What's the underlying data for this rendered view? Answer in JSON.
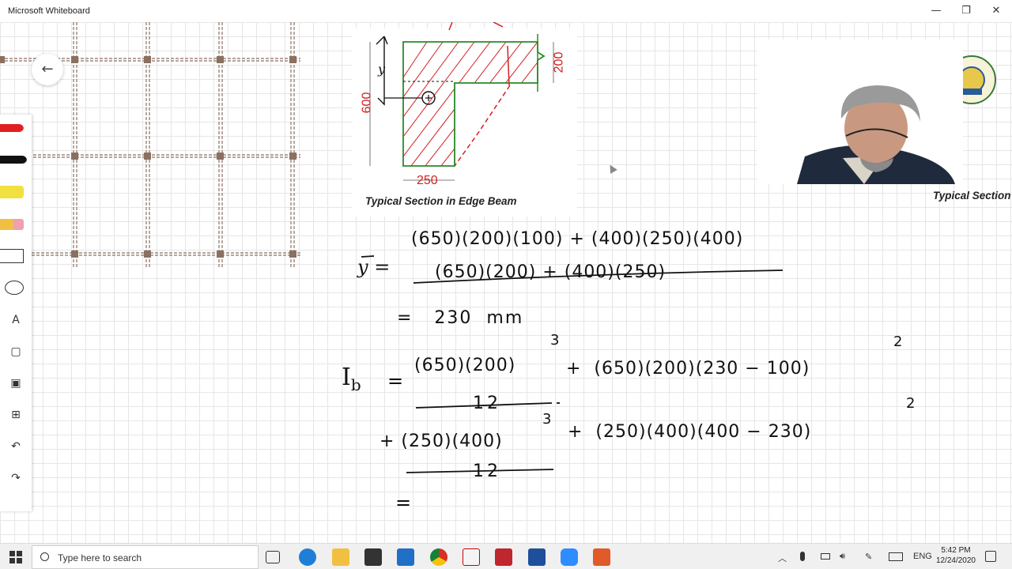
{
  "window": {
    "title": "Microsoft Whiteboard",
    "minimize_glyph": "—",
    "maximize_glyph": "❐",
    "close_glyph": "✕"
  },
  "board": {
    "back_glyph": "←",
    "tools": [
      {
        "name": "red-pen",
        "icon": "red-pen-icon",
        "color": "#e02020"
      },
      {
        "name": "black-pen",
        "icon": "black-pen-icon",
        "color": "#111111"
      },
      {
        "name": "highlighter",
        "icon": "highlighter-icon",
        "color": "#f2e040"
      },
      {
        "name": "eraser",
        "icon": "eraser-icon",
        "color": "#f0a0b0"
      },
      {
        "name": "ruler",
        "icon": "ruler-icon",
        "glyph": ""
      },
      {
        "name": "lasso",
        "icon": "lasso-icon",
        "glyph": ""
      },
      {
        "name": "text",
        "icon": "text-icon",
        "glyph": "A"
      },
      {
        "name": "note",
        "icon": "note-icon",
        "glyph": "▢"
      },
      {
        "name": "image",
        "icon": "image-icon",
        "glyph": "▣"
      },
      {
        "name": "add",
        "icon": "add-icon",
        "glyph": "⊞"
      },
      {
        "name": "undo",
        "icon": "undo-icon",
        "glyph": "↶"
      },
      {
        "name": "redo",
        "icon": "redo-icon",
        "glyph": "↷"
      }
    ],
    "section_figure": {
      "caption": "Typical Section in Edge Beam",
      "dim_height": "600",
      "dim_slab": "200",
      "dim_width": "250",
      "y_label": "y"
    },
    "right_caption": "Typical Section",
    "handwriting": {
      "ybar": "y =",
      "num1": "(650)(200)(100) + (400)(250)(400)",
      "den1": "(650)(200) + (400)(250)",
      "eq2": "=   230  mm",
      "ib_label": "I",
      "ib_sub": "b",
      "eq_sign": "=",
      "frac1_num": "(650)(200)",
      "exp3": "3",
      "den12": "12",
      "term2": "+  (650)(200)(230 − 100)",
      "exp2": "2",
      "frac2_num": "+ (250)(400)",
      "term4": "+  (250)(400)(400 − 230)",
      "eq_last": "="
    },
    "colors": {
      "accent_red": "#d42020",
      "outline_green": "#2a8a2a",
      "ink": "#111111",
      "frame_brown": "#8b7060"
    }
  },
  "taskbar": {
    "search_placeholder": "Type here to search",
    "lang": "ENG",
    "time": "5:42 PM",
    "date": "12/24/2020"
  }
}
